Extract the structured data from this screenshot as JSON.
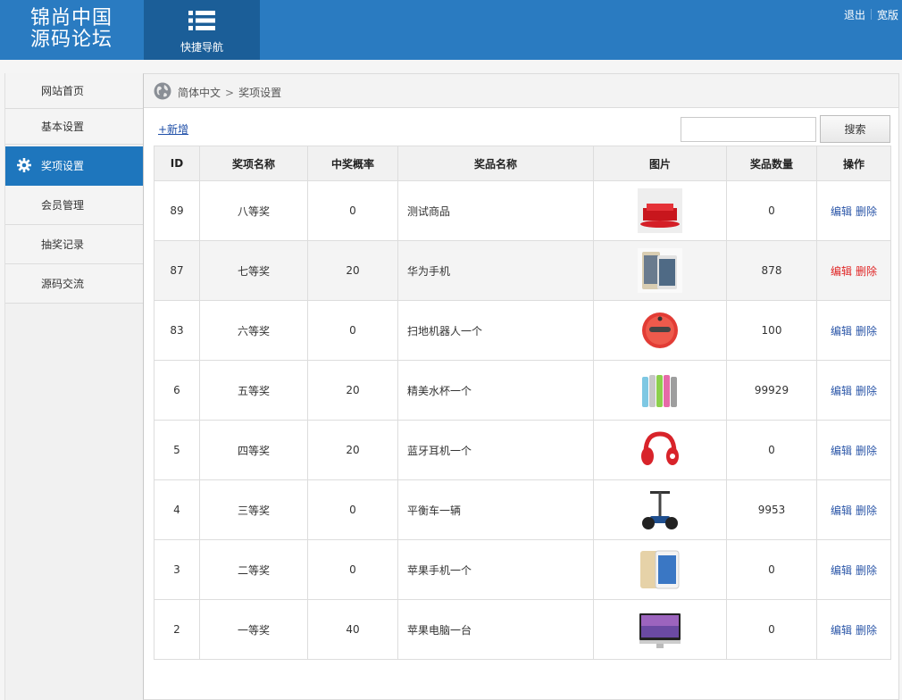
{
  "header": {
    "logo_line1": "锦尚中国",
    "logo_line2": "源码论坛",
    "quick_nav_label": "快捷导航",
    "logout": "退出",
    "wide": "宽版",
    "bg_color": "#2a7bc1"
  },
  "sidebar": {
    "items": [
      {
        "label": "网站首页"
      },
      {
        "label": "基本设置"
      },
      {
        "label": "奖项设置",
        "active": true,
        "icon": "gear-icon"
      },
      {
        "label": "会员管理"
      },
      {
        "label": "抽奖记录"
      },
      {
        "label": "源码交流"
      }
    ]
  },
  "breadcrumb": {
    "root": "简体中文",
    "sep": ">",
    "current": "奖项设置"
  },
  "toolbar": {
    "add_label": "+新增",
    "search_value": "",
    "search_button": "搜索"
  },
  "table": {
    "columns": [
      "ID",
      "奖项名称",
      "中奖概率",
      "奖品名称",
      "图片",
      "奖品数量",
      "操作"
    ],
    "edit_label": "编辑",
    "delete_label": "删除",
    "rows": [
      {
        "id": "89",
        "award": "八等奖",
        "prob": "0",
        "prize": "测试商品",
        "image": "red-box-image",
        "qty": "0"
      },
      {
        "id": "87",
        "award": "七等奖",
        "prob": "20",
        "prize": "华为手机",
        "image": "phone-image",
        "qty": "878",
        "highlighted": true
      },
      {
        "id": "83",
        "award": "六等奖",
        "prob": "0",
        "prize": "扫地机器人一个",
        "image": "robot-vacuum-image",
        "qty": "100"
      },
      {
        "id": "6",
        "award": "五等奖",
        "prob": "20",
        "prize": "精美水杯一个",
        "image": "bottles-image",
        "qty": "99929"
      },
      {
        "id": "5",
        "award": "四等奖",
        "prob": "20",
        "prize": "蓝牙耳机一个",
        "image": "headphones-image",
        "qty": "0"
      },
      {
        "id": "4",
        "award": "三等奖",
        "prob": "0",
        "prize": "平衡车一辆",
        "image": "balance-scooter-image",
        "qty": "9953"
      },
      {
        "id": "3",
        "award": "二等奖",
        "prob": "0",
        "prize": "苹果手机一个",
        "image": "iphone-image",
        "qty": "0"
      },
      {
        "id": "2",
        "award": "一等奖",
        "prob": "40",
        "prize": "苹果电脑一台",
        "image": "imac-image",
        "qty": "0"
      }
    ]
  }
}
